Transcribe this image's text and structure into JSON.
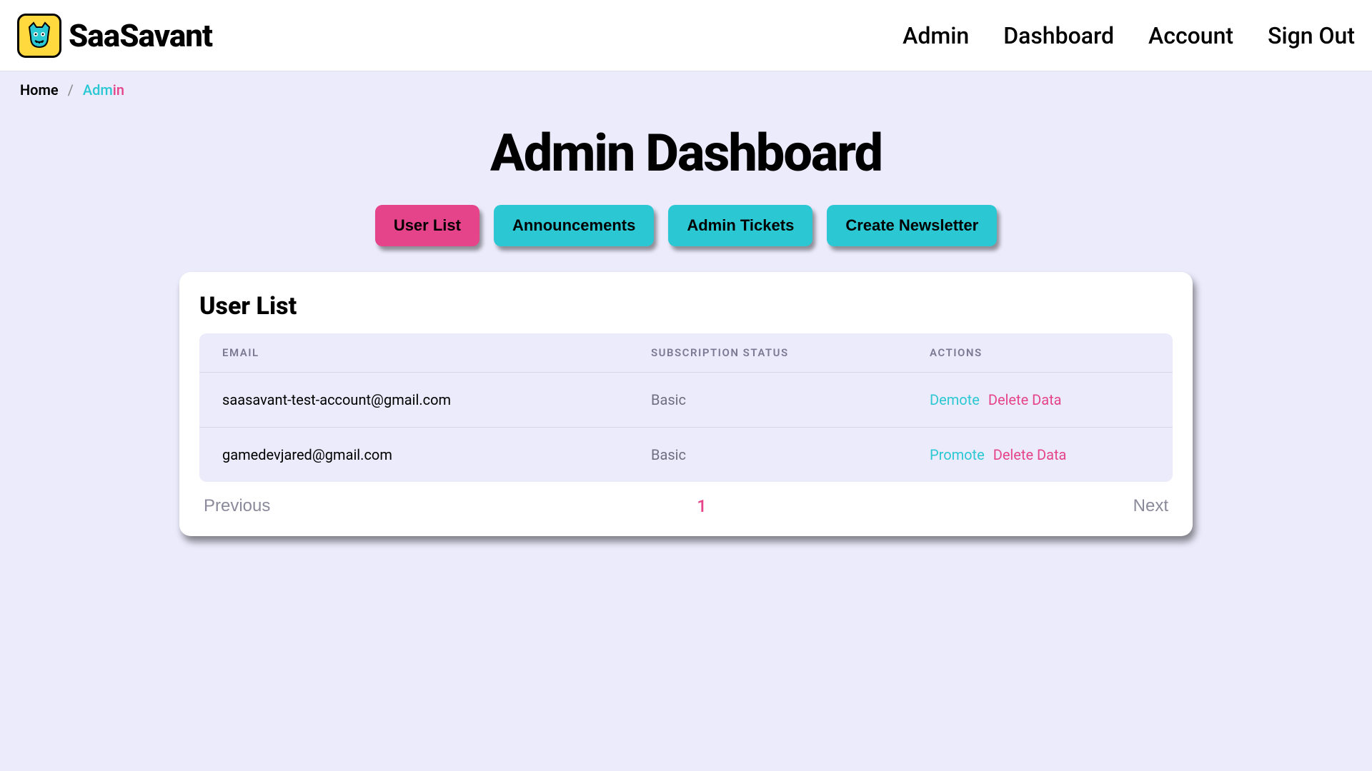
{
  "header": {
    "brand": "SaaSavant",
    "nav": {
      "admin": "Admin",
      "dashboard": "Dashboard",
      "account": "Account",
      "signout": "Sign Out"
    }
  },
  "breadcrumb": {
    "home": "Home",
    "current_part1": "Adm",
    "current_part2": "in"
  },
  "page": {
    "title": "Admin Dashboard"
  },
  "tabs": {
    "user_list": "User List",
    "announcements": "Announcements",
    "admin_tickets": "Admin Tickets",
    "create_newsletter": "Create Newsletter"
  },
  "user_list": {
    "title": "User List",
    "columns": {
      "email": "EMAIL",
      "subscription": "SUBSCRIPTION STATUS",
      "actions": "ACTIONS"
    },
    "rows": [
      {
        "email": "saasavant-test-account@gmail.com",
        "subscription": "Basic",
        "role_action": "Demote",
        "delete_action": "Delete Data"
      },
      {
        "email": "gamedevjared@gmail.com",
        "subscription": "Basic",
        "role_action": "Promote",
        "delete_action": "Delete Data"
      }
    ],
    "pager": {
      "previous": "Previous",
      "page": "1",
      "next": "Next"
    }
  }
}
